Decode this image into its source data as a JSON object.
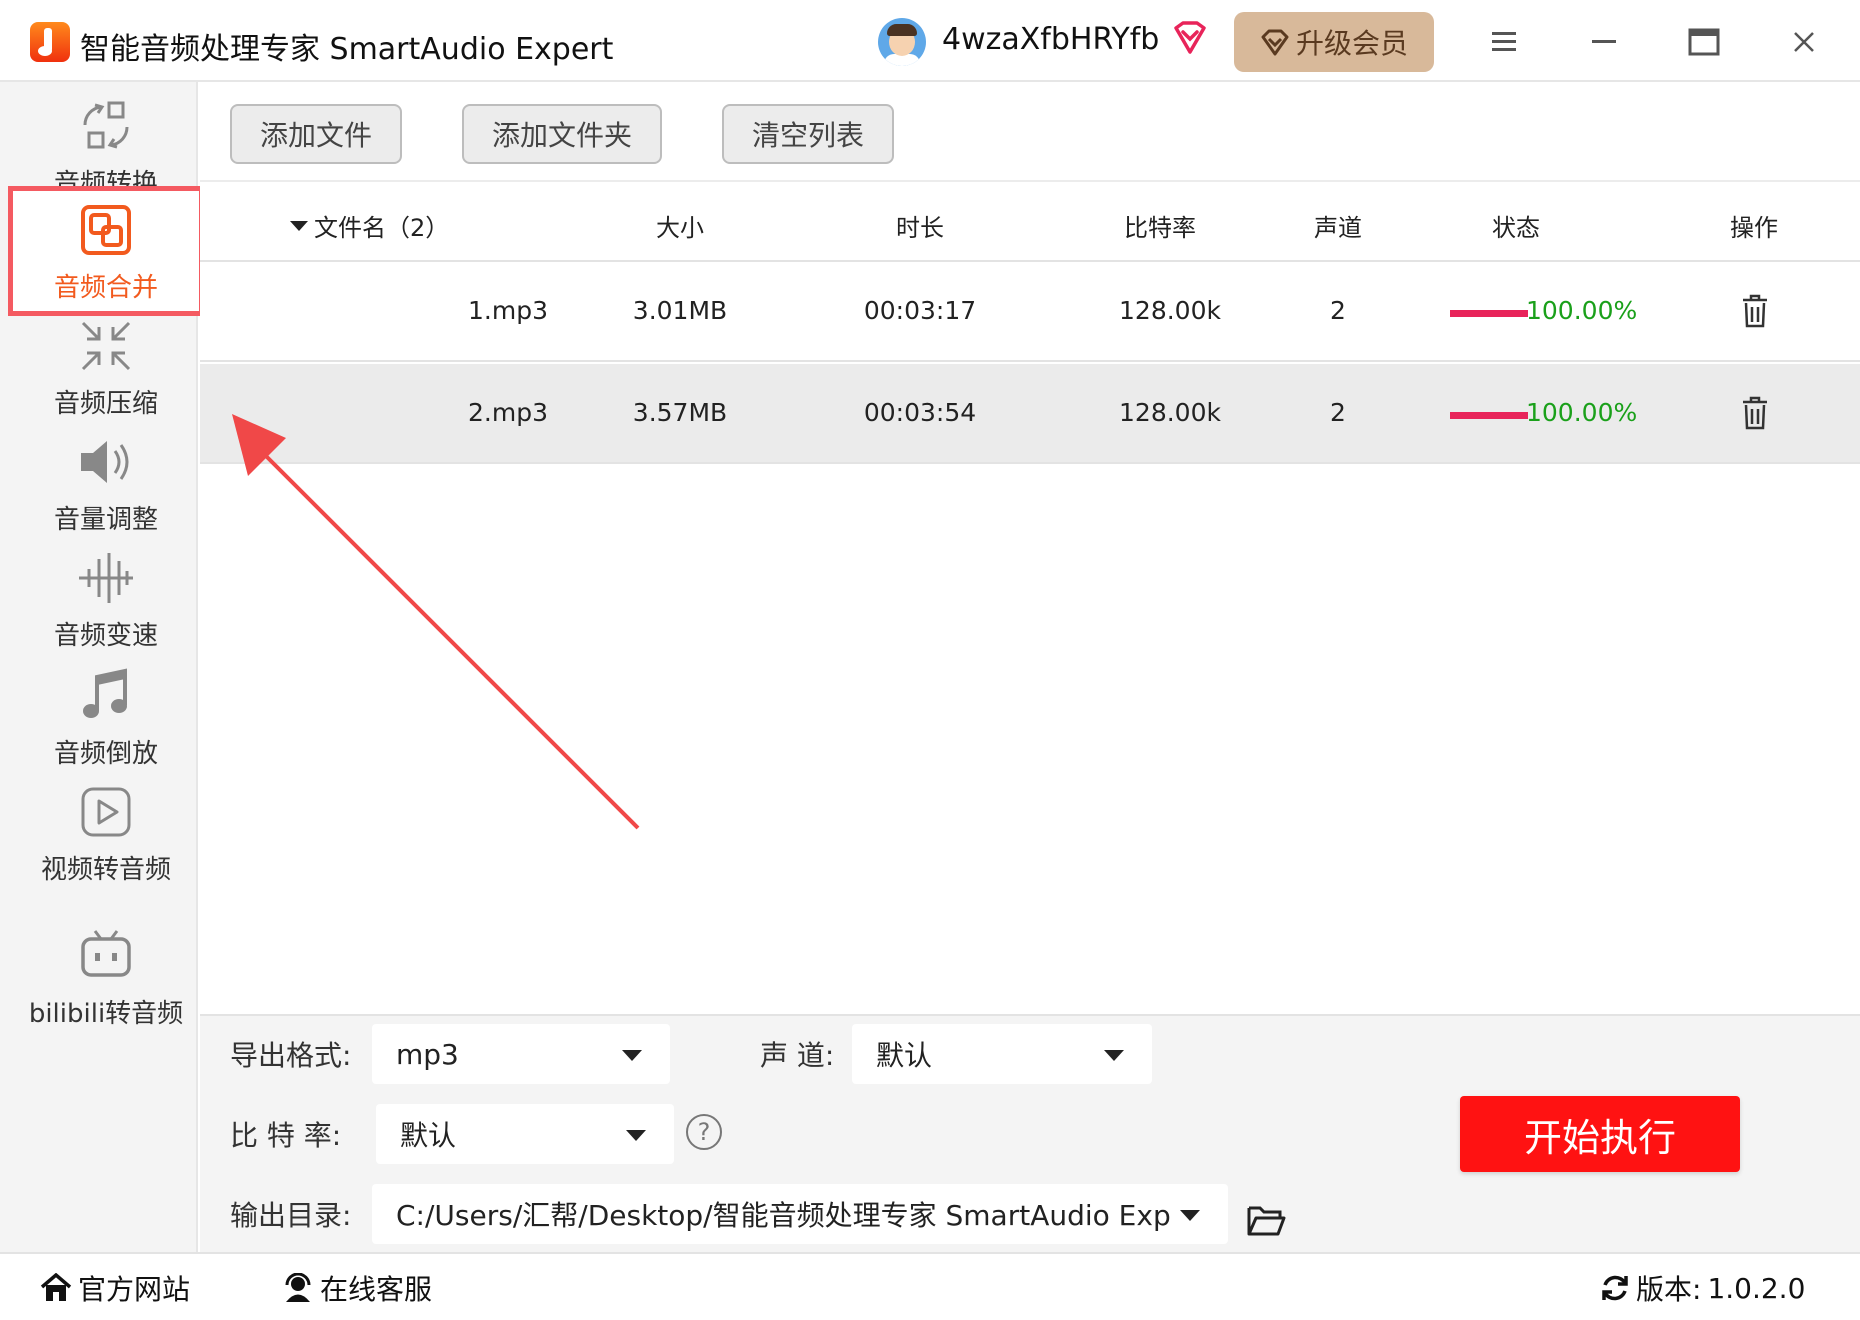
{
  "app": {
    "title": "智能音频处理专家 SmartAudio Expert",
    "username": "4wzaXfbHRYfb",
    "upgrade_label": "升级会员"
  },
  "colors": {
    "accent": "#f25a1e",
    "active_border": "#f45a61",
    "start_button": "#ff1212",
    "progress": "#e8245a",
    "progress_text": "#1aa01a"
  },
  "sidebar": {
    "items": [
      {
        "label": "音频转换",
        "icon": "audio-convert-icon"
      },
      {
        "label": "音频合并",
        "icon": "audio-merge-icon"
      },
      {
        "label": "音频压缩",
        "icon": "audio-compress-icon"
      },
      {
        "label": "音量调整",
        "icon": "volume-icon"
      },
      {
        "label": "音频变速",
        "icon": "speed-icon"
      },
      {
        "label": "音频倒放",
        "icon": "music-note-icon"
      },
      {
        "label": "视频转音频",
        "icon": "play-icon"
      },
      {
        "label": "bilibili转音频",
        "icon": "bilibili-icon"
      }
    ],
    "active_index": 1
  },
  "toolbar": {
    "add_file": "添加文件",
    "add_folder": "添加文件夹",
    "clear_list": "清空列表"
  },
  "table": {
    "headers": {
      "filename": "文件名（2）",
      "size": "大小",
      "duration": "时长",
      "bitrate": "比特率",
      "channels": "声道",
      "status": "状态",
      "action": "操作"
    },
    "rows": [
      {
        "filename": "1.mp3",
        "size": "3.01MB",
        "duration": "00:03:17",
        "bitrate": "128.00k",
        "channels": "2",
        "status": "100.00%"
      },
      {
        "filename": "2.mp3",
        "size": "3.57MB",
        "duration": "00:03:54",
        "bitrate": "128.00k",
        "channels": "2",
        "status": "100.00%"
      }
    ]
  },
  "settings": {
    "format_label": "导出格式:",
    "format_value": "mp3",
    "channel_label": "声 道:",
    "channel_value": "默认",
    "bitrate_label": "比 特 率:",
    "bitrate_value": "默认",
    "output_label": "输出目录:",
    "output_value": "C:/Users/汇帮/Desktop/智能音频处理专家 SmartAudio Exp",
    "start_label": "开始执行"
  },
  "statusbar": {
    "website": "官方网站",
    "support": "在线客服",
    "version_label": "版本:",
    "version_value": "1.0.2.0"
  }
}
